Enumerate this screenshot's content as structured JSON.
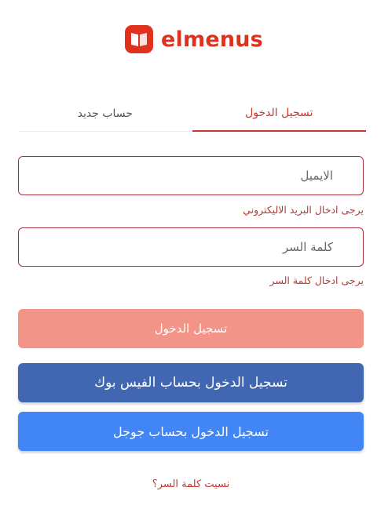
{
  "brand": {
    "name": "elmenus",
    "icon": "book-icon",
    "color": "#e0311f"
  },
  "tabs": [
    {
      "label": "تسجيل الدخول",
      "active": true
    },
    {
      "label": "حساب جديد",
      "active": false
    }
  ],
  "form": {
    "email": {
      "value": "",
      "placeholder": "الايميل",
      "error": "يرجى ادخال البريد الاليكتروني"
    },
    "password": {
      "value": "",
      "placeholder": "كلمة السر",
      "error": "يرجى ادخال كلمة السر"
    }
  },
  "buttons": {
    "login": "تسجيل الدخول",
    "facebook": "تسجيل الدخول بحساب الفيس بوك",
    "google": "تسجيل الدخول بحساب جوجل"
  },
  "forgot_password": "نسيت كلمة السر؟",
  "colors": {
    "accent": "#c8372d",
    "login_button": "#f29487",
    "facebook": "#4267b2",
    "google": "#4285f4",
    "field_border": "#a4303a"
  }
}
